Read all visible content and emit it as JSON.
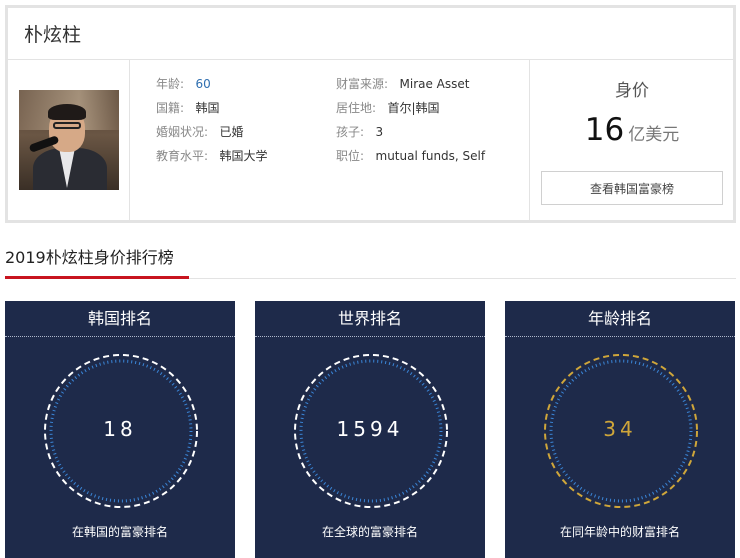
{
  "profile": {
    "name": "朴炫柱",
    "fields": [
      {
        "label": "年龄:",
        "value": "60"
      },
      {
        "label": "国籍:",
        "value": "韩国"
      },
      {
        "label": "婚姻状况:",
        "value": "已婚"
      },
      {
        "label": "教育水平:",
        "value": "韩国大学"
      },
      {
        "label": "财富来源:",
        "value": "Mirae Asset"
      },
      {
        "label": "居住地:",
        "value": "首尔|韩国"
      },
      {
        "label": "孩子:",
        "value": "3"
      },
      {
        "label": "职位:",
        "value": "mutual funds, Self"
      }
    ]
  },
  "worth": {
    "title": "身价",
    "amount": "16",
    "unit": "亿美元",
    "button_label": "查看韩国富豪榜"
  },
  "section": {
    "title": "2019朴炫柱身价排行榜"
  },
  "ranks": [
    {
      "title": "韩国排名",
      "value": "18",
      "caption": "在韩国的富豪排名"
    },
    {
      "title": "世界排名",
      "value": "1594",
      "caption": "在全球的富豪排名"
    },
    {
      "title": "年龄排名",
      "value": "34",
      "caption": "在同年龄中的财富排名"
    }
  ],
  "colors": {
    "card_bg": "#1e2a4a",
    "accent_red": "#c8141f",
    "ring_blue": "#3a86d8",
    "ring_gold": "#cfa63a",
    "link_blue": "#2f6fb0"
  }
}
